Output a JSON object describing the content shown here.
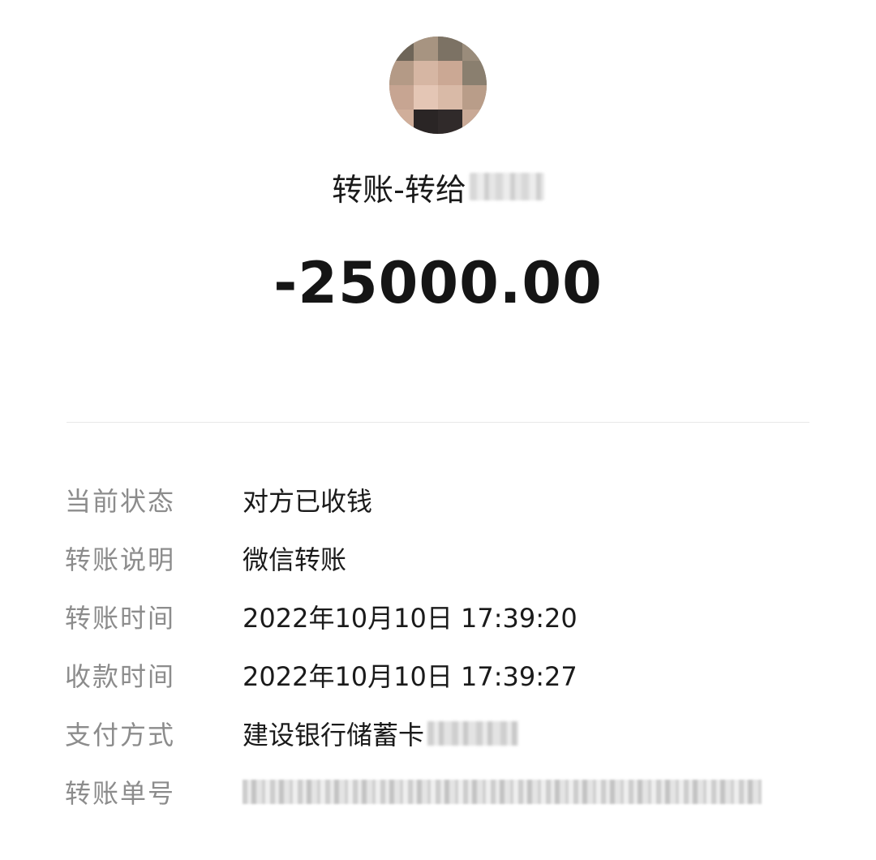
{
  "header": {
    "title_prefix": "转账-转给",
    "amount": "-25000.00"
  },
  "details": [
    {
      "label": "当前状态",
      "value": "对方已收钱"
    },
    {
      "label": "转账说明",
      "value": "微信转账"
    },
    {
      "label": "转账时间",
      "value": "2022年10月10日 17:39:20"
    },
    {
      "label": "收款时间",
      "value": "2022年10月10日 17:39:27"
    },
    {
      "label": "支付方式",
      "value": "建设银行储蓄卡"
    },
    {
      "label": "转账单号",
      "value": ""
    }
  ]
}
